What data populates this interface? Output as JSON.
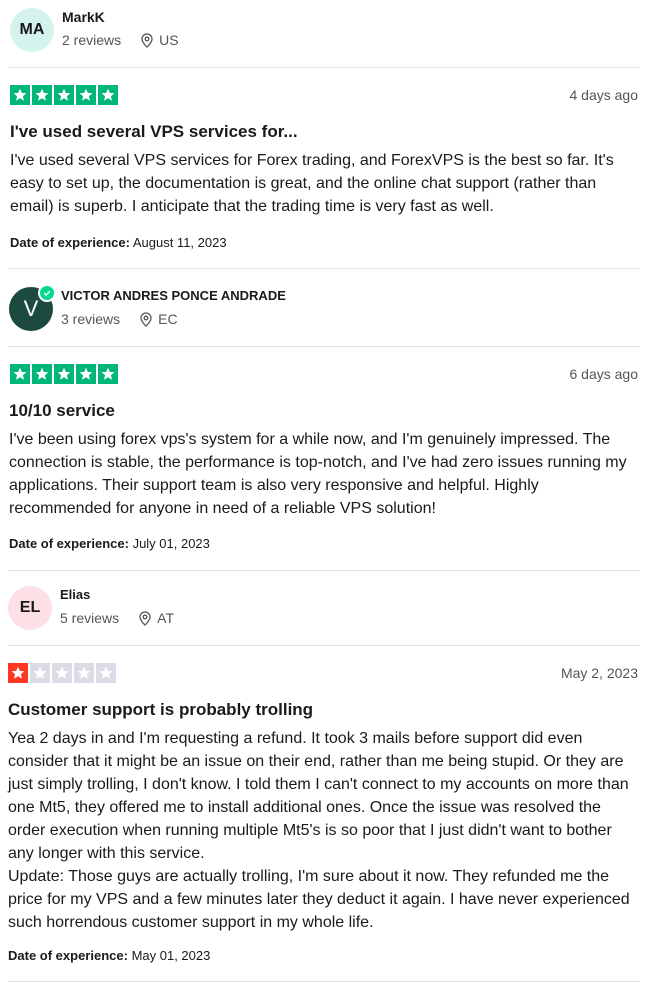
{
  "reviews": [
    {
      "initials": "MA",
      "name": "MarkK",
      "review_count": "2 reviews",
      "country": "US",
      "rating": 5,
      "date": "4 days ago",
      "title": "I've used several VPS services for...",
      "body": "I've used several VPS services for Forex trading, and ForexVPS is the best so far. It's easy to set up, the documentation is great, and the online chat support (rather than email) is superb. I anticipate that the trading time is very fast as well.",
      "experience_label": "Date of experience:",
      "experience_date": "August 11, 2023",
      "avatar_color": "#d4f3ee"
    },
    {
      "initials": "V",
      "name": "VICTOR ANDRES PONCE ANDRADE",
      "review_count": "3 reviews",
      "country": "EC",
      "rating": 5,
      "date": "6 days ago",
      "title": "10/10 service",
      "body": "I've been using forex vps's system for a while now, and I'm genuinely impressed. The connection is stable, the performance is top-notch, and I've had zero issues running my applications. Their support team is also very responsive and helpful. Highly recommended for anyone in need of a reliable VPS solution!",
      "experience_label": "Date of experience:",
      "experience_date": "July 01, 2023",
      "avatar_color": "#1d4a40"
    },
    {
      "initials": "EL",
      "name": "Elias",
      "review_count": "5 reviews",
      "country": "AT",
      "rating": 1,
      "date": "May 2, 2023",
      "title": "Customer support is probably trolling",
      "body": "Yea 2 days in and I'm requesting a refund. It took 3 mails before support did even consider that it might be an issue on their end, rather than me being stupid. Or they are just simply trolling, I don't know. I told them I can't connect to my accounts on more than one Mt5, they offered me to install additional ones. Once the issue was resolved the order execution when running multiple Mt5's is so poor that I just didn't want to bother any longer with this service.\nUpdate: Those guys are actually trolling, I'm sure about it now. They refunded me the price for my VPS and a few minutes later they deduct it again. I have never experienced such horrendous customer support in my whole life.",
      "experience_label": "Date of experience:",
      "experience_date": "May 01, 2023",
      "avatar_color": "#fde0e6"
    }
  ],
  "colors": {
    "star_5": "#00b67a",
    "star_1": "#ff3722",
    "star_empty": "#dcdce6",
    "verified": "#04da8d"
  },
  "icons": [
    "location-pin-icon",
    "star-icon",
    "verified-badge-icon"
  ]
}
